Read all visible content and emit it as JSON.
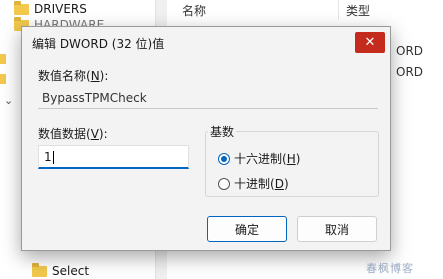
{
  "background": {
    "tree_items": [
      "DRIVERS",
      "HARDWARE",
      "Select"
    ],
    "list_headers": {
      "name": "名称",
      "type": "类型"
    },
    "type_fragments": [
      "ORD",
      "ORD"
    ],
    "watermark": "春枫博客"
  },
  "dialog": {
    "title": "编辑 DWORD (32 位)值",
    "close_glyph": "✕",
    "value_name_label": "数值名称(",
    "value_name_key": "N",
    "value_name": "BypassTPMCheck",
    "value_data_label": "数值数据(",
    "value_data_key": "V",
    "value_data": "1",
    "base_label": "基数",
    "base_options": [
      {
        "label": "十六进制(",
        "key": "H",
        "selected": true
      },
      {
        "label": "十进制(",
        "key": "D",
        "selected": false
      }
    ],
    "ok_label": "确定",
    "cancel_label": "取消"
  }
}
